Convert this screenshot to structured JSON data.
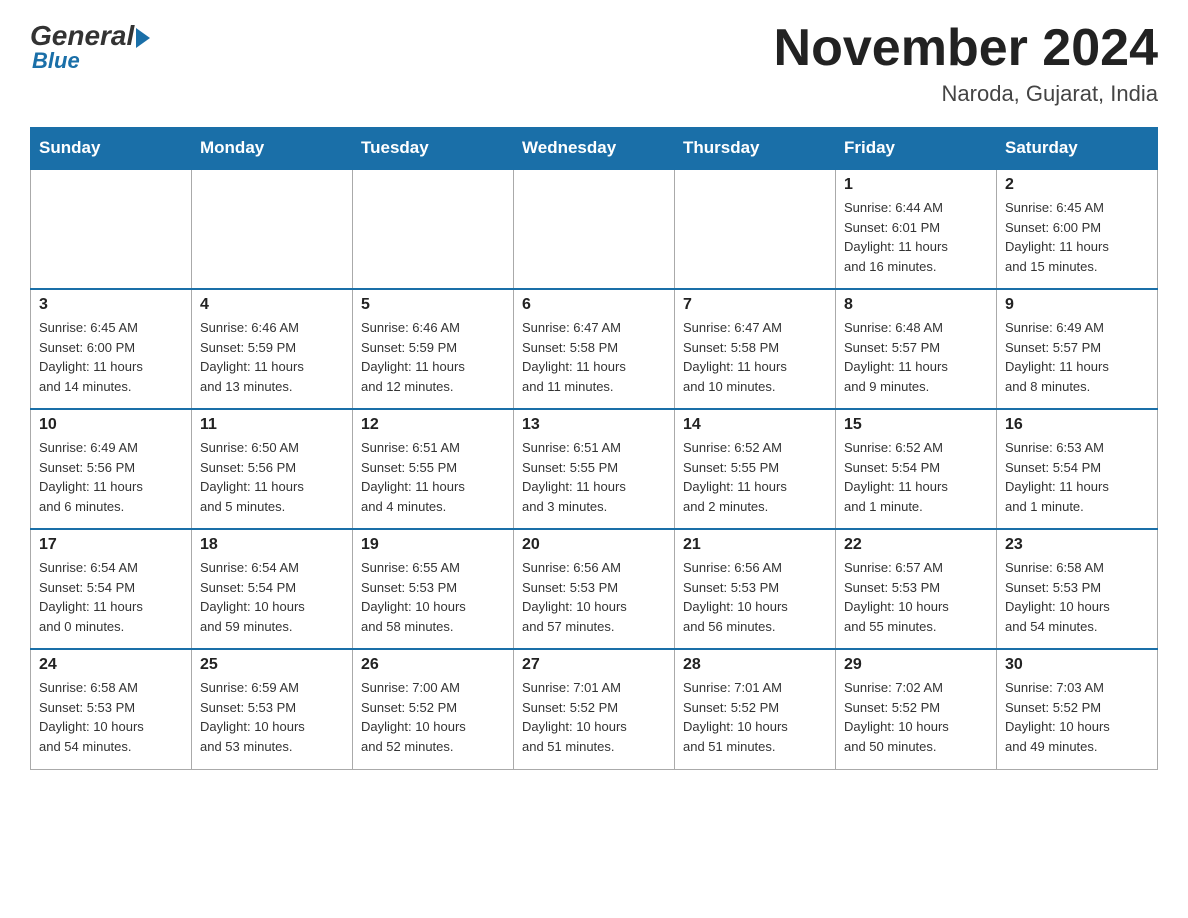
{
  "logo": {
    "general": "General",
    "blue": "Blue"
  },
  "header": {
    "month": "November 2024",
    "location": "Naroda, Gujarat, India"
  },
  "weekdays": [
    "Sunday",
    "Monday",
    "Tuesday",
    "Wednesday",
    "Thursday",
    "Friday",
    "Saturday"
  ],
  "weeks": [
    [
      {
        "day": "",
        "info": ""
      },
      {
        "day": "",
        "info": ""
      },
      {
        "day": "",
        "info": ""
      },
      {
        "day": "",
        "info": ""
      },
      {
        "day": "",
        "info": ""
      },
      {
        "day": "1",
        "info": "Sunrise: 6:44 AM\nSunset: 6:01 PM\nDaylight: 11 hours\nand 16 minutes."
      },
      {
        "day": "2",
        "info": "Sunrise: 6:45 AM\nSunset: 6:00 PM\nDaylight: 11 hours\nand 15 minutes."
      }
    ],
    [
      {
        "day": "3",
        "info": "Sunrise: 6:45 AM\nSunset: 6:00 PM\nDaylight: 11 hours\nand 14 minutes."
      },
      {
        "day": "4",
        "info": "Sunrise: 6:46 AM\nSunset: 5:59 PM\nDaylight: 11 hours\nand 13 minutes."
      },
      {
        "day": "5",
        "info": "Sunrise: 6:46 AM\nSunset: 5:59 PM\nDaylight: 11 hours\nand 12 minutes."
      },
      {
        "day": "6",
        "info": "Sunrise: 6:47 AM\nSunset: 5:58 PM\nDaylight: 11 hours\nand 11 minutes."
      },
      {
        "day": "7",
        "info": "Sunrise: 6:47 AM\nSunset: 5:58 PM\nDaylight: 11 hours\nand 10 minutes."
      },
      {
        "day": "8",
        "info": "Sunrise: 6:48 AM\nSunset: 5:57 PM\nDaylight: 11 hours\nand 9 minutes."
      },
      {
        "day": "9",
        "info": "Sunrise: 6:49 AM\nSunset: 5:57 PM\nDaylight: 11 hours\nand 8 minutes."
      }
    ],
    [
      {
        "day": "10",
        "info": "Sunrise: 6:49 AM\nSunset: 5:56 PM\nDaylight: 11 hours\nand 6 minutes."
      },
      {
        "day": "11",
        "info": "Sunrise: 6:50 AM\nSunset: 5:56 PM\nDaylight: 11 hours\nand 5 minutes."
      },
      {
        "day": "12",
        "info": "Sunrise: 6:51 AM\nSunset: 5:55 PM\nDaylight: 11 hours\nand 4 minutes."
      },
      {
        "day": "13",
        "info": "Sunrise: 6:51 AM\nSunset: 5:55 PM\nDaylight: 11 hours\nand 3 minutes."
      },
      {
        "day": "14",
        "info": "Sunrise: 6:52 AM\nSunset: 5:55 PM\nDaylight: 11 hours\nand 2 minutes."
      },
      {
        "day": "15",
        "info": "Sunrise: 6:52 AM\nSunset: 5:54 PM\nDaylight: 11 hours\nand 1 minute."
      },
      {
        "day": "16",
        "info": "Sunrise: 6:53 AM\nSunset: 5:54 PM\nDaylight: 11 hours\nand 1 minute."
      }
    ],
    [
      {
        "day": "17",
        "info": "Sunrise: 6:54 AM\nSunset: 5:54 PM\nDaylight: 11 hours\nand 0 minutes."
      },
      {
        "day": "18",
        "info": "Sunrise: 6:54 AM\nSunset: 5:54 PM\nDaylight: 10 hours\nand 59 minutes."
      },
      {
        "day": "19",
        "info": "Sunrise: 6:55 AM\nSunset: 5:53 PM\nDaylight: 10 hours\nand 58 minutes."
      },
      {
        "day": "20",
        "info": "Sunrise: 6:56 AM\nSunset: 5:53 PM\nDaylight: 10 hours\nand 57 minutes."
      },
      {
        "day": "21",
        "info": "Sunrise: 6:56 AM\nSunset: 5:53 PM\nDaylight: 10 hours\nand 56 minutes."
      },
      {
        "day": "22",
        "info": "Sunrise: 6:57 AM\nSunset: 5:53 PM\nDaylight: 10 hours\nand 55 minutes."
      },
      {
        "day": "23",
        "info": "Sunrise: 6:58 AM\nSunset: 5:53 PM\nDaylight: 10 hours\nand 54 minutes."
      }
    ],
    [
      {
        "day": "24",
        "info": "Sunrise: 6:58 AM\nSunset: 5:53 PM\nDaylight: 10 hours\nand 54 minutes."
      },
      {
        "day": "25",
        "info": "Sunrise: 6:59 AM\nSunset: 5:53 PM\nDaylight: 10 hours\nand 53 minutes."
      },
      {
        "day": "26",
        "info": "Sunrise: 7:00 AM\nSunset: 5:52 PM\nDaylight: 10 hours\nand 52 minutes."
      },
      {
        "day": "27",
        "info": "Sunrise: 7:01 AM\nSunset: 5:52 PM\nDaylight: 10 hours\nand 51 minutes."
      },
      {
        "day": "28",
        "info": "Sunrise: 7:01 AM\nSunset: 5:52 PM\nDaylight: 10 hours\nand 51 minutes."
      },
      {
        "day": "29",
        "info": "Sunrise: 7:02 AM\nSunset: 5:52 PM\nDaylight: 10 hours\nand 50 minutes."
      },
      {
        "day": "30",
        "info": "Sunrise: 7:03 AM\nSunset: 5:52 PM\nDaylight: 10 hours\nand 49 minutes."
      }
    ]
  ]
}
